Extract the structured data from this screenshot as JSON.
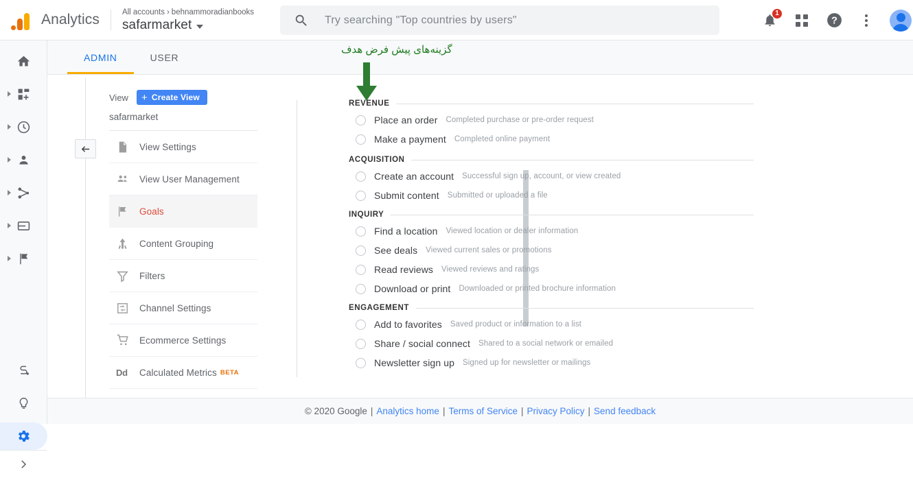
{
  "topbar": {
    "product_name": "Analytics",
    "breadcrumb_root": "All accounts",
    "breadcrumb_sep": "›",
    "breadcrumb_account": "behnammoradianbooks",
    "property_name": "safarmarket",
    "search_placeholder": "Try searching \"Top countries by users\"",
    "notification_count": "1"
  },
  "rail": {
    "items": [
      {
        "name": "home",
        "icon": "home-icon",
        "expandable": false
      },
      {
        "name": "customization",
        "icon": "dashboard-add-icon",
        "expandable": true
      },
      {
        "name": "realtime",
        "icon": "clock-icon",
        "expandable": true
      },
      {
        "name": "audience",
        "icon": "person-icon",
        "expandable": true
      },
      {
        "name": "acquisition",
        "icon": "share-node-icon",
        "expandable": true
      },
      {
        "name": "behavior",
        "icon": "card-icon",
        "expandable": true
      },
      {
        "name": "conversions",
        "icon": "flag-icon",
        "expandable": true
      }
    ],
    "bottom_items": [
      {
        "name": "attribution",
        "icon": "attribution-icon"
      },
      {
        "name": "discover",
        "icon": "lightbulb-icon"
      },
      {
        "name": "admin",
        "icon": "gear-icon",
        "active": true
      }
    ],
    "expand_icon": "chevron-right-icon"
  },
  "tabs": [
    {
      "label": "ADMIN",
      "active": true
    },
    {
      "label": "USER",
      "active": false
    }
  ],
  "annotation": {
    "text": "گزینه‌های پیش فرض هدف",
    "color": "#1f7a1f",
    "arrow": "down-arrow-icon"
  },
  "admin_panel": {
    "column_label": "View",
    "create_button": "Create View",
    "create_button_icon": "plus-icon",
    "view_name": "safarmarket",
    "collapse_icon": "arrow-left-icon",
    "menu": [
      {
        "label": "View Settings",
        "icon": "document-icon",
        "active": false
      },
      {
        "label": "View User Management",
        "icon": "people-icon",
        "active": false
      },
      {
        "label": "Goals",
        "icon": "flag-icon",
        "active": true
      },
      {
        "label": "Content Grouping",
        "icon": "content-grouping-icon",
        "active": false
      },
      {
        "label": "Filters",
        "icon": "funnel-icon",
        "active": false
      },
      {
        "label": "Channel Settings",
        "icon": "channel-settings-icon",
        "active": false
      },
      {
        "label": "Ecommerce Settings",
        "icon": "cart-icon",
        "active": false
      },
      {
        "label": "Calculated Metrics",
        "icon": "dd-icon",
        "badge": "BETA",
        "active": false
      }
    ]
  },
  "goal_templates": {
    "sections": [
      {
        "title": "REVENUE",
        "goals": [
          {
            "name": "Place an order",
            "desc": "Completed purchase or pre-order request"
          },
          {
            "name": "Make a payment",
            "desc": "Completed online payment"
          }
        ]
      },
      {
        "title": "ACQUISITION",
        "goals": [
          {
            "name": "Create an account",
            "desc": "Successful sign up, account, or view created"
          },
          {
            "name": "Submit content",
            "desc": "Submitted or uploaded a file"
          }
        ]
      },
      {
        "title": "INQUIRY",
        "goals": [
          {
            "name": "Find a location",
            "desc": "Viewed location or dealer information"
          },
          {
            "name": "See deals",
            "desc": "Viewed current sales or promotions"
          },
          {
            "name": "Read reviews",
            "desc": "Viewed reviews and ratings"
          },
          {
            "name": "Download or print",
            "desc": "Downloaded or printed brochure information"
          }
        ]
      },
      {
        "title": "ENGAGEMENT",
        "goals": [
          {
            "name": "Add to favorites",
            "desc": "Saved product or information to a list"
          },
          {
            "name": "Share / social connect",
            "desc": "Shared to a social network or emailed"
          },
          {
            "name": "Newsletter sign up",
            "desc": "Signed up for newsletter or mailings"
          }
        ]
      }
    ]
  },
  "footer": {
    "copyright": "© 2020 Google",
    "links": [
      "Analytics home",
      "Terms of Service",
      "Privacy Policy",
      "Send feedback"
    ]
  }
}
